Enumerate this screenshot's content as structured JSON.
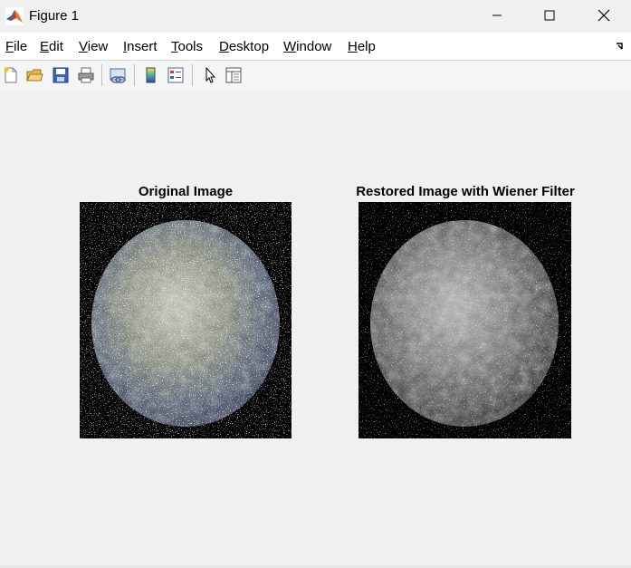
{
  "window": {
    "title": "Figure 1",
    "controls": [
      "minimize",
      "maximize",
      "close"
    ]
  },
  "menu": {
    "items": [
      {
        "key": "F",
        "rest": "ile"
      },
      {
        "key": "E",
        "rest": "dit"
      },
      {
        "key": "V",
        "rest": "iew"
      },
      {
        "key": "I",
        "rest": "nsert"
      },
      {
        "key": "T",
        "rest": "ools"
      },
      {
        "key": "D",
        "rest": "esktop"
      },
      {
        "key": "W",
        "rest": "indow"
      },
      {
        "key": "H",
        "rest": "elp"
      }
    ]
  },
  "toolbar": {
    "icons": [
      "new-figure-icon",
      "open-file-icon",
      "save-icon",
      "print-icon",
      "link-plot-icon",
      "colorbar-icon",
      "legend-icon",
      "pointer-icon",
      "property-inspector-icon"
    ]
  },
  "axes": [
    {
      "title": "Original Image",
      "colormap": "color"
    },
    {
      "title": "Restored Image with Wiener Filter",
      "colormap": "grayscale"
    }
  ],
  "colors": {
    "titlebar": "#f0f0f0",
    "menubar": "#ffffff",
    "figure_background": "#f0f0f0",
    "image_background": "#000000"
  }
}
